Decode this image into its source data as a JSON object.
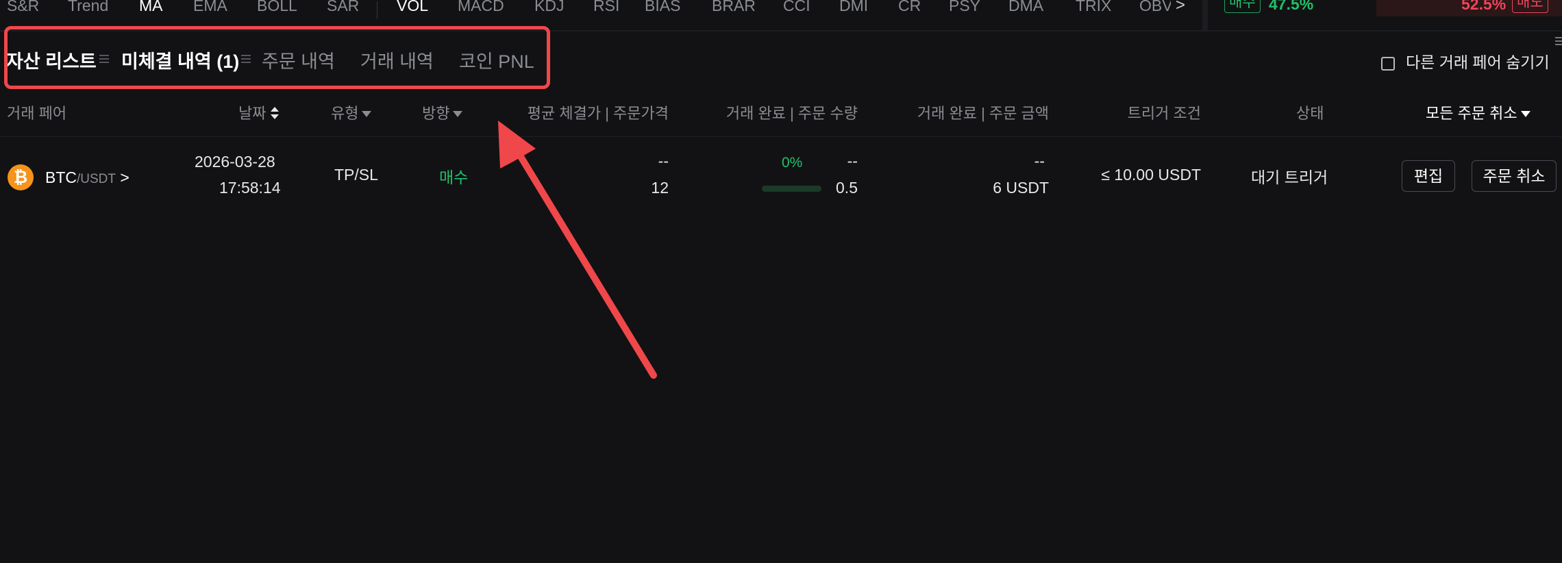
{
  "indicators": [
    {
      "label": "S&R",
      "active": false
    },
    {
      "label": "Trend",
      "active": false
    },
    {
      "label": "MA",
      "active": true
    },
    {
      "label": "EMA",
      "active": false
    },
    {
      "label": "BOLL",
      "active": false
    },
    {
      "label": "SAR",
      "active": false
    },
    {
      "label": "VOL",
      "active": true
    },
    {
      "label": "MACD",
      "active": false
    },
    {
      "label": "KDJ",
      "active": false
    },
    {
      "label": "RSI",
      "active": false
    },
    {
      "label": "BIAS",
      "active": false
    },
    {
      "label": "BRAR",
      "active": false
    },
    {
      "label": "CCI",
      "active": false
    },
    {
      "label": "DMI",
      "active": false
    },
    {
      "label": "CR",
      "active": false
    },
    {
      "label": "PSY",
      "active": false
    },
    {
      "label": "DMA",
      "active": false
    },
    {
      "label": "TRIX",
      "active": false
    },
    {
      "label": "OBV",
      "active": false
    }
  ],
  "indicators_next": ">",
  "ratio": {
    "buy_label": "매수",
    "buy_pct": "47.5%",
    "sell_pct": "52.5%",
    "sell_label": "매도",
    "buy_fraction": 0.475
  },
  "tabs": {
    "assets": "자산 리스트",
    "open_orders": "미체결 내역",
    "open_orders_count": "(1)",
    "order_history": "주문 내역",
    "trade_history": "거래 내역",
    "coin_pnl": "코인 PNL"
  },
  "hide_other_pairs": "다른 거래 페어 숨기기",
  "columns": {
    "pair": "거래 페어",
    "date": "날짜",
    "type": "유형",
    "side": "방향",
    "price": "평균 체결가 | 주문가격",
    "amount": "거래 완료 | 주문 수량",
    "total": "거래 완료 | 주문 금액",
    "trigger": "트리거 조건",
    "status": "상태",
    "cancel_all": "모든 주문 취소"
  },
  "order": {
    "coin_icon": "₿",
    "base": "BTC",
    "quote": "/USDT",
    "chevron": ">",
    "date": "2026-03-28",
    "time": "17:58:14",
    "type": "TP/SL",
    "side": "매수",
    "avg_price": "--",
    "order_price": "12",
    "filled_pct": "0%",
    "filled_fraction": 0,
    "filled_qty": "--",
    "order_qty": "0.5",
    "filled_value": "--",
    "order_value": "6 USDT",
    "trigger": "≤ 10.00 USDT",
    "status": "대기 트리거",
    "edit": "편집",
    "cancel": "주문 취소"
  },
  "colors": {
    "background": "#121214",
    "buy": "#22c06a",
    "sell": "#f0455b",
    "highlight": "#f0474a"
  }
}
